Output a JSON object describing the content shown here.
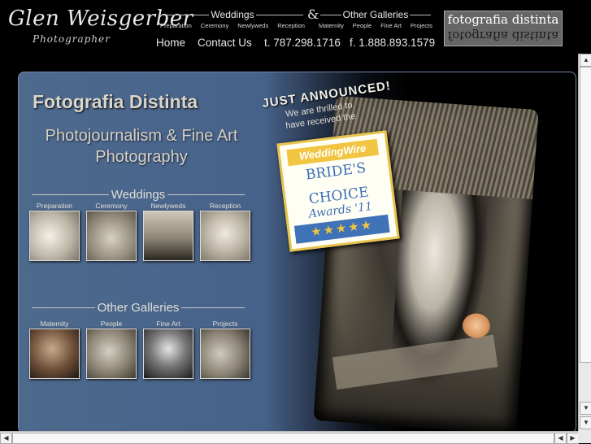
{
  "header": {
    "logo_name": "Glen Weisgerber",
    "logo_sub": "Photographer",
    "weddings_title": "Weddings",
    "weddings_items": [
      "Preparation",
      "Ceremony",
      "Newlyweds",
      "Reception"
    ],
    "amp": "&",
    "galleries_title": "Other Galleries",
    "galleries_items": [
      "Maternity",
      "People",
      "Fine Art",
      "Projects"
    ],
    "brand_box": "fotografia distinta",
    "nav": {
      "home": "Home",
      "contact": "Contact Us",
      "phone": "t. 787.298.1716",
      "fax": "f. 1.888.893.1579"
    }
  },
  "main": {
    "title": "Fotografia Distinta",
    "subtitle_1": "Photojournalism & Fine Art",
    "subtitle_2": "Photography",
    "weddings_section": "Weddings",
    "wedding_thumbs": [
      "Preparation",
      "Ceremony",
      "Newlyweds",
      "Reception"
    ],
    "galleries_section": "Other Galleries",
    "gallery_thumbs": [
      "Maternity",
      "People",
      "Fine Art",
      "Projects"
    ],
    "announcement": "JUST ANNOUNCED!",
    "announcement_line1": "We are thrilled to",
    "announcement_line2": "have received the",
    "badge": {
      "brand": "WeddingWire",
      "line1": "BRIDE'S",
      "line2": "CHOICE",
      "line3": "Awards '11",
      "stars": "★★★★★"
    }
  },
  "colors": {
    "panel_blue": "#47628a",
    "badge_gold": "#f1c542",
    "badge_blue": "#3b6fb5"
  }
}
